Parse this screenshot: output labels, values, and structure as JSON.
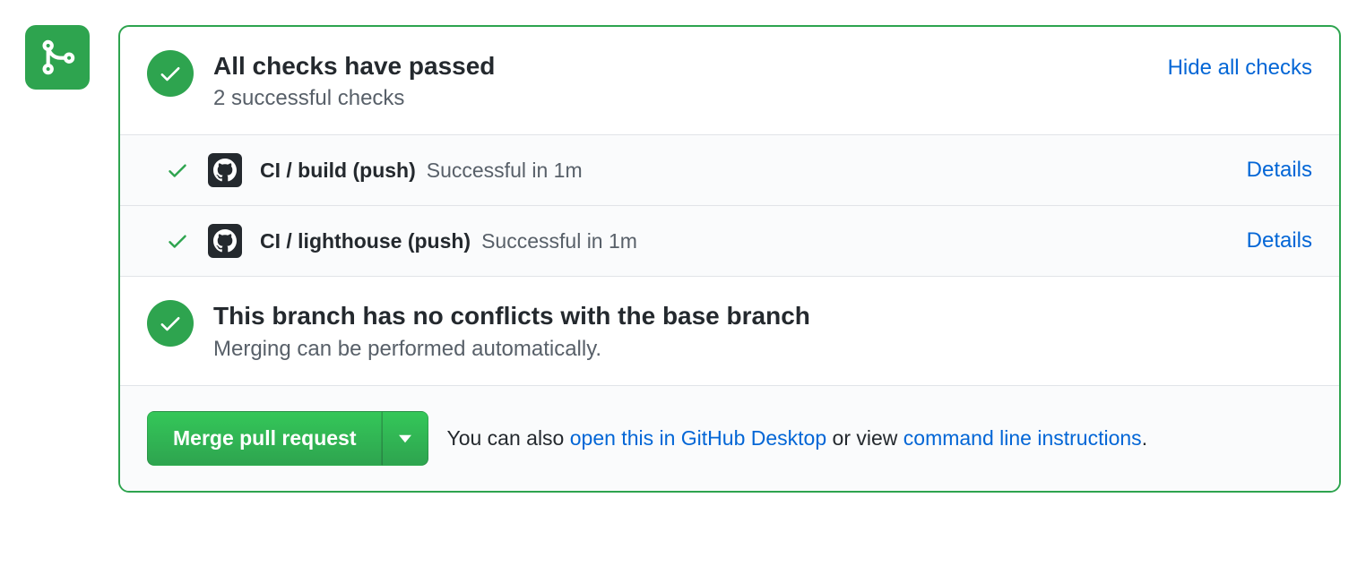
{
  "status": {
    "title": "All checks have passed",
    "subtitle": "2 successful checks",
    "toggle_link": "Hide all checks"
  },
  "checks": [
    {
      "name": "CI / build (push)",
      "result": "Successful in 1m",
      "details_label": "Details"
    },
    {
      "name": "CI / lighthouse (push)",
      "result": "Successful in 1m",
      "details_label": "Details"
    }
  ],
  "conflicts": {
    "title": "This branch has no conflicts with the base branch",
    "subtitle": "Merging can be performed automatically."
  },
  "merge": {
    "button_label": "Merge pull request",
    "footer_prefix": "You can also ",
    "open_desktop": "open this in GitHub Desktop",
    "footer_middle": " or view ",
    "cli_instructions": "command line instructions",
    "footer_suffix": "."
  }
}
